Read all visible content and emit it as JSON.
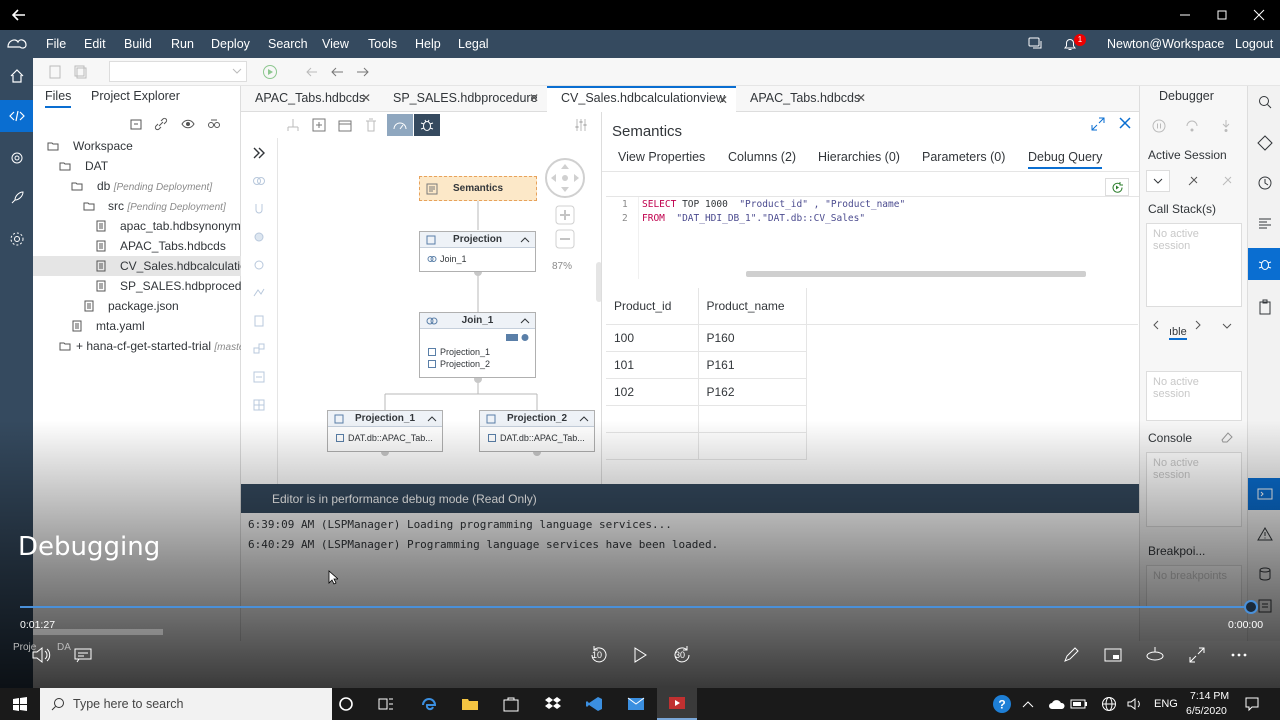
{
  "menu": {
    "items": [
      "File",
      "Edit",
      "Build",
      "Run",
      "Deploy",
      "Search",
      "View",
      "Tools",
      "Help",
      "Legal"
    ],
    "user": "Newton@Workspace",
    "logout": "Logout",
    "notification_count": "1"
  },
  "files_panel": {
    "tabs": [
      "Files",
      "Project Explorer"
    ],
    "tree": [
      {
        "label": "Workspace",
        "pending": ""
      },
      {
        "label": "DAT",
        "pending": ""
      },
      {
        "label": "db",
        "pending": "[Pending Deployment]"
      },
      {
        "label": "src",
        "pending": "[Pending Deployment]"
      },
      {
        "label": "apac_tab.hdbsynonym",
        "pending": ""
      },
      {
        "label": "APAC_Tabs.hdbcds",
        "pending": ""
      },
      {
        "label": "CV_Sales.hdbcalculatic",
        "pending": ""
      },
      {
        "label": "SP_SALES.hdbprocedu",
        "pending": ""
      },
      {
        "label": "package.json",
        "pending": ""
      },
      {
        "label": "mta.yaml",
        "pending": ""
      },
      {
        "label": "+ hana-cf-get-started-trial",
        "pending": "[maste"
      }
    ]
  },
  "editor_tabs": [
    "APAC_Tabs.hdbcds",
    "SP_SALES.hdbprocedure",
    "CV_Sales.hdbcalculationview",
    "APAC_Tabs.hdbcds"
  ],
  "diagram": {
    "zoom": "87%",
    "nodes": {
      "semantics": "Semantics",
      "projection": {
        "title": "Projection",
        "rows": [
          "Join_1"
        ]
      },
      "join1": {
        "title": "Join_1",
        "rows": [
          "Projection_1",
          "Projection_2"
        ]
      },
      "projection1": {
        "title": "Projection_1",
        "rows": [
          "DAT.db::APAC_Tab..."
        ]
      },
      "projection2": {
        "title": "Projection_2",
        "rows": [
          "DAT.db::APAC_Tab..."
        ]
      }
    }
  },
  "semantics": {
    "title": "Semantics",
    "tabs": [
      "View Properties",
      "Columns (2)",
      "Hierarchies (0)",
      "Parameters (0)",
      "Debug Query"
    ],
    "code": {
      "line1_no": "1",
      "line2_no": "2",
      "line1_kw": "SELECT",
      "line1_rest_kw": "TOP",
      "line1_num": "1000",
      "line1_cols": "\"Product_id\" , \"Product_name\"",
      "line2_kw": "FROM",
      "line2_src": "\"DAT_HDI_DB_1\".\"DAT.db::CV_Sales\""
    },
    "result": {
      "headers": [
        "Product_id",
        "Product_name"
      ],
      "rows": [
        [
          "100",
          "P160"
        ],
        [
          "101",
          "P161"
        ],
        [
          "102",
          "P162"
        ]
      ]
    }
  },
  "debugger": {
    "title": "Debugger",
    "active_session": "Active Session",
    "call_stack": "Call Stack(s)",
    "no_session": "No active session",
    "variables_tab": "ıble",
    "console": "Console",
    "breakpoints": "Breakpoi...",
    "no_breakpoints": "No breakpoints"
  },
  "console": {
    "banner": "Editor is in performance debug mode (Read Only)",
    "lines": [
      "6:39:09 AM (LSPManager) Loading programming language services...",
      "6:40:29 AM (LSPManager) Programming language services have been loaded."
    ]
  },
  "video": {
    "title": "Debugging",
    "elapsed": "0:01:27",
    "remaining": "0:00:00",
    "progress": 1.0,
    "skip_back": "10",
    "skip_fwd": "30",
    "bottom_left": "Proje",
    "bottom_left2": "DA"
  },
  "taskbar": {
    "search_placeholder": "Type here to search",
    "lang": "ENG",
    "time": "7:14 PM",
    "date": "6/5/2020"
  },
  "colors": {
    "shell": "#354a5f",
    "accent": "#0a6ed1",
    "semantics_node": "#fce8c8"
  }
}
